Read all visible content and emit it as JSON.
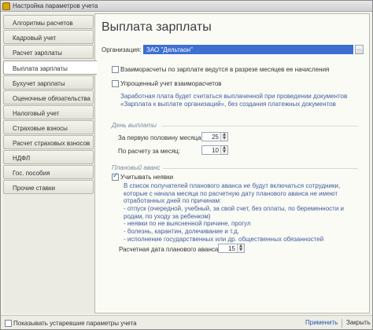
{
  "window": {
    "title": "Настройка параметров учета"
  },
  "sidebar": {
    "items": [
      {
        "label": "Алгоритмы расчетов"
      },
      {
        "label": "Кадровый учет"
      },
      {
        "label": "Расчет зарплаты"
      },
      {
        "label": "Выплата зарплаты"
      },
      {
        "label": "Бухучет зарплаты"
      },
      {
        "label": "Оценочные обязательства"
      },
      {
        "label": "Налоговый учет"
      },
      {
        "label": "Страховые взносы"
      },
      {
        "label": "Расчет страховых взносов"
      },
      {
        "label": "НДФЛ"
      },
      {
        "label": "Гос. пособия"
      },
      {
        "label": "Прочие ставки"
      }
    ],
    "active_index": 3
  },
  "main": {
    "title": "Выплата зарплаты",
    "org_label": "Организация:",
    "org_value": "ЗАО \"Дельтаон\"",
    "mutual_settlements": {
      "label": "Взаиморасчеты по зарплате ведутся в разрезе месяцев ее начисления",
      "checked": false
    },
    "simplified": {
      "label": "Упрощенный учет взаиморасчетов",
      "checked": false
    },
    "simplified_note": "Заработная плата будет считаться выплаченной при проведении документов «Зарплата к выплате организаций», без создания платежных документов",
    "payday_section": "День выплаты",
    "first_half_label": "За первую половину месяца:",
    "first_half_value": "25",
    "month_label": "По расчету за месяц:",
    "month_value": "10",
    "advance_section": "Плановый аванс",
    "consider_absences": {
      "label": "Учитывать неявки",
      "checked": true
    },
    "advance_note": "В список получателей планового аванса не будут включаться сотрудники, которые с начала месяца по расчетную дату планового аванса не имеют отработанных дней по причинам:",
    "advance_reasons": [
      "- отпуск (очередной, учебный, за свой счет, без оплаты, по беременности и родам, по уходу за ребенком)",
      "- неявки по не выясненной причине, прогул",
      "- болезнь, карантин, долечивание и т.д.",
      "- исполнение государственных или др. общественных обязанностей"
    ],
    "advance_date_label": "Расчетная дата планового аванса:",
    "advance_date_value": "15"
  },
  "footer": {
    "show_obsolete_label": "Показывать устаревшие параметры учета",
    "show_obsolete_checked": false,
    "apply_label": "Применить",
    "close_label": "Закрыть"
  },
  "colors": {
    "accent": "#3d6fd1",
    "note_text": "#3f5d9b",
    "section_text": "#7a8a9e"
  }
}
